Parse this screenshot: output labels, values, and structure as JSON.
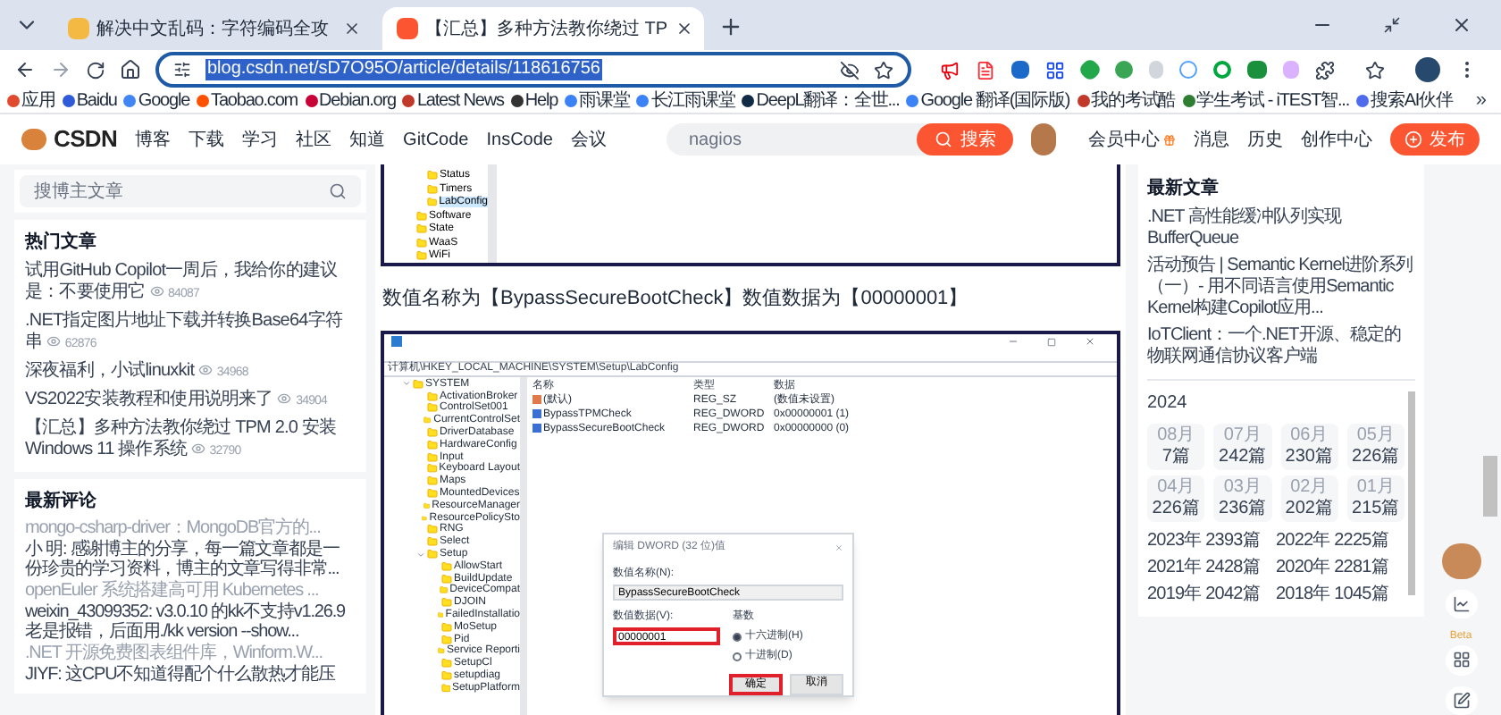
{
  "browser": {
    "tabs": [
      {
        "title": "解决中文乱码：字符编码全攻",
        "selected": false
      },
      {
        "title": "【汇总】多种方法教你绕过 TP",
        "selected": true
      }
    ],
    "address": "blog.csdn.net/sD7O95O/article/details/118616756",
    "bookmarks": [
      {
        "label": "应用",
        "color": "#e04a2f"
      },
      {
        "label": "Baidu",
        "color": "#2f5bd8"
      },
      {
        "label": "Google",
        "color": "#4285f4"
      },
      {
        "label": "Taobao.com",
        "color": "#ff5000"
      },
      {
        "label": "Debian.org",
        "color": "#c70036"
      },
      {
        "label": "Latest News",
        "color": "#c0392b"
      },
      {
        "label": "Help",
        "color": "#333333"
      },
      {
        "label": "雨课堂",
        "color": "#3b82f6"
      },
      {
        "label": "长江雨课堂",
        "color": "#3b82f6"
      },
      {
        "label": "DeepL翻译：全世...",
        "color": "#0f2b46"
      },
      {
        "label": "Google 翻译(国际版)",
        "color": "#3b82f6"
      },
      {
        "label": "我的考试酷",
        "color": "#c0392b"
      },
      {
        "label": "学生考试 - iTEST智...",
        "color": "#2e7d32"
      },
      {
        "label": "搜索AI伙伴",
        "color": "#4f6bed"
      }
    ],
    "more": "»"
  },
  "nav": {
    "logo": "CSDN",
    "items": [
      "博客",
      "下载",
      "学习",
      "社区",
      "知道",
      "GitCode",
      "InsCode",
      "会议"
    ],
    "search": "nagios",
    "search_button": "搜索",
    "links": [
      "会员中心",
      "消息",
      "历史",
      "创作中心"
    ],
    "publish": "发布"
  },
  "left": {
    "search_placeholder": "搜博主文章",
    "hot": {
      "title": "热门文章",
      "items": [
        {
          "title": "试用GitHub Copilot一周后，我给你的建议是：不要使用它",
          "views": "84087"
        },
        {
          "title": ".NET指定图片地址下载并转换Base64字符串",
          "views": "62876"
        },
        {
          "title": "深夜福利，小试linuxkit",
          "views": "34968"
        },
        {
          "title": "VS2022安装教程和使用说明来了",
          "views": "34904"
        },
        {
          "title": "【汇总】多种方法教你绕过 TPM 2.0 安装 Windows 11 操作系统",
          "views": "32790"
        }
      ]
    },
    "comments": {
      "title": "最新评论",
      "items": [
        {
          "source": "mongo-csharp-driver：MongoDB官方的...",
          "text": "小 明: 感谢博主的分享，每一篇文章都是一份珍贵的学习资料，博主的文章写得非常..."
        },
        {
          "source": "openEuler 系统搭建高可用 Kubernetes ...",
          "text": "weixin_43099352: v3.0.10 的kk不支持v1.26.9 老是报错，后面用./kk version --show..."
        },
        {
          "source": ".NET 开源免费图表组件库，Winform.W...",
          "text": "JIYF: 这CPU不知道得配个什么散热才能压"
        }
      ]
    }
  },
  "article": {
    "top_tree": [
      {
        "name": "Status",
        "selected": false
      },
      {
        "name": "Timers",
        "selected": false
      },
      {
        "name": "LabConfig",
        "selected": true
      },
      {
        "name": "Software",
        "selected": false
      },
      {
        "name": "State",
        "selected": false
      },
      {
        "name": "WaaS",
        "selected": false
      },
      {
        "name": "WiFi",
        "selected": false
      }
    ],
    "caption": "数值名称为【BypassSecureBootCheck】数值数据为【00000001】",
    "regedit": {
      "address": "计算机\\HKEY_LOCAL_MACHINE\\SYSTEM\\Setup\\LabConfig",
      "tree": [
        {
          "name": "SYSTEM",
          "expanded": true,
          "children": [
            {
              "name": "ActivationBroker"
            },
            {
              "name": "ControlSet001"
            },
            {
              "name": "CurrentControlSet"
            },
            {
              "name": "DriverDatabase"
            },
            {
              "name": "HardwareConfig"
            },
            {
              "name": "Input"
            },
            {
              "name": "Keyboard Layout"
            },
            {
              "name": "Maps"
            },
            {
              "name": "MountedDevices"
            },
            {
              "name": "ResourceManager"
            },
            {
              "name": "ResourcePolicySto"
            },
            {
              "name": "RNG"
            },
            {
              "name": "Select"
            },
            {
              "name": "Setup",
              "expanded": true,
              "children": [
                {
                  "name": "AllowStart"
                },
                {
                  "name": "BuildUpdate"
                },
                {
                  "name": "DeviceCompat"
                },
                {
                  "name": "DJOIN"
                },
                {
                  "name": "FailedInstallatio"
                },
                {
                  "name": "MoSetup"
                },
                {
                  "name": "Pid"
                },
                {
                  "name": "Service Reporti"
                },
                {
                  "name": "SetupCl"
                },
                {
                  "name": "setupdiag"
                },
                {
                  "name": "SetupPlatform"
                }
              ]
            }
          ]
        }
      ],
      "columns": [
        "名称",
        "类型",
        "数据"
      ],
      "values": [
        {
          "name": "(默认)",
          "type": "REG_SZ",
          "data": "(数值未设置)",
          "kind": "string"
        },
        {
          "name": "BypassTPMCheck",
          "type": "REG_DWORD",
          "data": "0x00000001 (1)",
          "kind": "dword"
        },
        {
          "name": "BypassSecureBootCheck",
          "type": "REG_DWORD",
          "data": "0x00000000 (0)",
          "kind": "dword"
        }
      ],
      "dialog": {
        "title": "编辑 DWORD (32 位)值",
        "name_label": "数值名称(N):",
        "name": "BypassSecureBootCheck",
        "data_label": "数值数据(V):",
        "data": "00000001",
        "base_label": "基数",
        "bases": [
          {
            "label": "十六进制(H)",
            "selected": true
          },
          {
            "label": "十进制(D)",
            "selected": false
          }
        ],
        "ok": "确定",
        "cancel": "取消"
      }
    }
  },
  "right": {
    "latest": {
      "title": "最新文章",
      "items": [
        ".NET 高性能缓冲队列实现 BufferQueue",
        "活动预告 | Semantic Kernel进阶系列（一）- 用不同语言使用Semantic Kernel构建Copilot应用...",
        "IoTClient：一个.NET开源、稳定的物联网通信协议客户端"
      ]
    },
    "archive": {
      "year": "2024",
      "months": [
        {
          "month": "08月",
          "count": "7篇"
        },
        {
          "month": "07月",
          "count": "242篇"
        },
        {
          "month": "06月",
          "count": "230篇"
        },
        {
          "month": "05月",
          "count": "226篇"
        },
        {
          "month": "04月",
          "count": "226篇"
        },
        {
          "month": "03月",
          "count": "236篇"
        },
        {
          "month": "02月",
          "count": "202篇"
        },
        {
          "month": "01月",
          "count": "215篇"
        }
      ],
      "years": [
        {
          "year": "2023年",
          "count": "2393篇"
        },
        {
          "year": "2022年",
          "count": "2225篇"
        },
        {
          "year": "2021年",
          "count": "2428篇"
        },
        {
          "year": "2020年",
          "count": "2281篇"
        },
        {
          "year": "2019年",
          "count": "2042篇"
        },
        {
          "year": "2018年",
          "count": "1045篇"
        }
      ]
    },
    "beta": "Beta"
  }
}
